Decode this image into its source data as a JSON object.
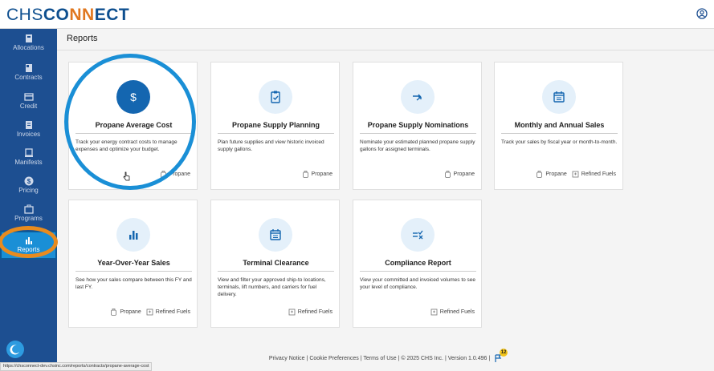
{
  "brand": {
    "part1": "CHS",
    "part2": "CO",
    "part3": "NN",
    "part4": "ECT"
  },
  "page_title": "Reports",
  "sidebar": {
    "items": [
      {
        "label": "Allocations",
        "icon": "allocations-icon"
      },
      {
        "label": "Contracts",
        "icon": "contracts-icon"
      },
      {
        "label": "Credit",
        "icon": "credit-icon"
      },
      {
        "label": "Invoices",
        "icon": "invoices-icon"
      },
      {
        "label": "Manifests",
        "icon": "manifests-icon"
      },
      {
        "label": "Pricing",
        "icon": "pricing-icon"
      },
      {
        "label": "Programs",
        "icon": "programs-icon"
      },
      {
        "label": "Reports",
        "icon": "reports-icon",
        "active": true
      }
    ]
  },
  "cards": [
    {
      "title": "Propane Average Cost",
      "desc": "Track your energy contract costs to manage expenses and optimize your budget.",
      "tags": [
        "Propane"
      ],
      "icon": "dollar-icon"
    },
    {
      "title": "Propane Supply Planning",
      "desc": "Plan future supplies and view historic invoiced supply gallons.",
      "tags": [
        "Propane"
      ],
      "icon": "clipboard-check-icon"
    },
    {
      "title": "Propane Supply Nominations",
      "desc": "Nominate your estimated planned propane supply gallons for assigned terminals.",
      "tags": [
        "Propane"
      ],
      "icon": "arrows-icon"
    },
    {
      "title": "Monthly and Annual Sales",
      "desc": "Track your sales by fiscal year or month-to-month.",
      "tags": [
        "Propane",
        "Refined Fuels"
      ],
      "icon": "calendar-icon"
    },
    {
      "title": "Year-Over-Year Sales",
      "desc": "See how your sales compare between this FY and last FY.",
      "tags": [
        "Propane",
        "Refined Fuels"
      ],
      "icon": "bar-chart-icon"
    },
    {
      "title": "Terminal Clearance",
      "desc": "View and filter your approved ship-to locations, terminals, lift numbers, and carriers for fuel delivery.",
      "tags": [
        "Refined Fuels"
      ],
      "icon": "calendar-icon"
    },
    {
      "title": "Compliance Report",
      "desc": "View your committed and invoiced volumes to see your level of compliance.",
      "tags": [
        "Refined Fuels"
      ],
      "icon": "compliance-icon"
    }
  ],
  "footer": {
    "privacy": "Privacy Notice",
    "cookies": "Cookie Preferences",
    "terms": "Terms of Use",
    "copyright": "© 2025 CHS Inc.",
    "version": "Version 1.0.496",
    "badge": "12",
    "sep": "|"
  },
  "status_url": "https://chsconnect-dev.chsinc.com/reports/contracts/propane-average-cost",
  "colors": {
    "brand_blue": "#1d4f91",
    "accent": "#1a8fd6",
    "highlight_orange": "#e88b1e"
  }
}
